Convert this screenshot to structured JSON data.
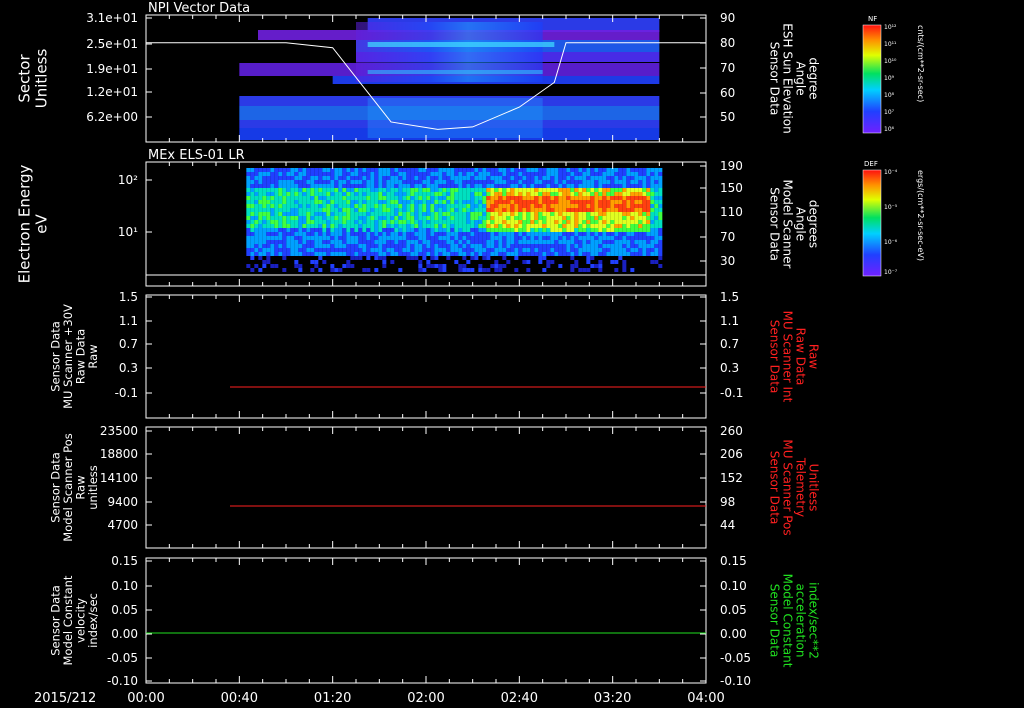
{
  "date_label": "2015/212",
  "x_ticks": [
    "00:00",
    "00:40",
    "01:20",
    "02:00",
    "02:40",
    "03:20",
    "04:00"
  ],
  "colorbars": [
    {
      "tag": "NF",
      "unit": "cnts/(cm**2-sr-sec)",
      "max_label": "10¹²",
      "min_label": "10⁶",
      "mid_labels": [
        "10¹¹",
        "10¹⁰",
        "10⁹",
        "10⁸",
        "10⁷"
      ]
    },
    {
      "tag": "DEF",
      "unit": "ergs/(cm**2-sr-sec-eV)",
      "max_label": "10⁻⁴",
      "min_label": "10⁻⁷",
      "mid_labels": [
        "10⁻⁵",
        "10⁻⁶"
      ]
    }
  ],
  "panels": [
    {
      "title": "NPI Vector Data",
      "left_label": [
        "Sector",
        "Unitless"
      ],
      "right_label": [
        "Sensor Data",
        "ESH Sun Elevation",
        "Angle",
        "degree"
      ],
      "right_label_color": "#ffffff",
      "left_ticks": [
        "3.1e+01",
        "2.5e+01",
        "1.9e+01",
        "1.2e+01",
        "6.2e+00"
      ],
      "right_ticks": [
        "90",
        "80",
        "70",
        "60",
        "50"
      ]
    },
    {
      "title": "MEx ELS-01 LR",
      "left_label": [
        "Electron Energy",
        "eV"
      ],
      "right_label": [
        "Sensor Data",
        "Model Scanner",
        "Angle",
        "degrees"
      ],
      "right_label_color": "#ffffff",
      "left_ticks": [
        "10²",
        "10¹"
      ],
      "right_ticks": [
        "190",
        "150",
        "110",
        "70",
        "30"
      ]
    },
    {
      "title": "",
      "left_label": [
        "Sensor Data",
        "MU Scanner +30V",
        "Raw Data",
        "Raw"
      ],
      "right_label": [
        "Sensor Data",
        "MU Scanner Int",
        "Raw Data",
        "Raw"
      ],
      "right_label_color": "#ff2020",
      "left_ticks": [
        "1.5",
        "1.1",
        "0.7",
        "0.3",
        "-0.1"
      ],
      "right_ticks": [
        "1.5",
        "1.1",
        "0.7",
        "0.3",
        "-0.1"
      ]
    },
    {
      "title": "",
      "left_label": [
        "Sensor Data",
        "Model Scanner Pos",
        "Raw",
        "unitless"
      ],
      "right_label": [
        "Sensor Data",
        "MU Scanner Pos",
        "Telemetry",
        "Unitless"
      ],
      "right_label_color": "#ff2020",
      "left_ticks": [
        "23500",
        "18800",
        "14100",
        "9400",
        "4700"
      ],
      "right_ticks": [
        "260",
        "206",
        "152",
        "98",
        "44"
      ]
    },
    {
      "title": "",
      "left_label": [
        "Sensor Data",
        "Model Constant",
        "velocity",
        "index/sec"
      ],
      "right_label": [
        "Sensor Data",
        "Model Constant",
        "acceleration",
        "index/sec**2"
      ],
      "right_label_color": "#20e020",
      "left_ticks": [
        "0.15",
        "0.10",
        "0.05",
        "0.00",
        "-0.05",
        "-0.10"
      ],
      "right_ticks": [
        "0.15",
        "0.10",
        "0.05",
        "0.00",
        "-0.05",
        "-0.10"
      ]
    }
  ],
  "chart_data": [
    {
      "type": "heatmap",
      "title": "NPI Vector Data",
      "ylabel": "Sector Unitless",
      "x_range": [
        "00:00",
        "04:00"
      ],
      "data_start": "00:40",
      "data_end": "03:40",
      "overlay_series": {
        "name": "Sensor Data ESH Sun Elevation Angle",
        "unit": "degree",
        "x": [
          "00:00",
          "01:00",
          "01:20",
          "01:30",
          "01:45",
          "02:05",
          "02:20",
          "02:40",
          "02:55",
          "03:00",
          "04:00"
        ],
        "y": [
          80,
          80,
          78,
          66,
          48,
          45,
          46,
          54,
          64,
          80,
          80
        ]
      }
    },
    {
      "type": "heatmap",
      "title": "MEx ELS-01 LR",
      "ylabel": "Electron Energy eV",
      "yscale": "log",
      "x_range": [
        "00:00",
        "04:00"
      ],
      "data_start": "00:43",
      "data_end": "03:40",
      "overlay_series": {
        "name": "Sensor Data Model Scanner Angle",
        "unit": "degrees",
        "x": [
          "00:00",
          "04:00"
        ],
        "y": [
          -10,
          -10
        ]
      }
    },
    {
      "type": "line",
      "ylabel": "Sensor Data MU Scanner +30V Raw Data Raw",
      "ylim": [
        -0.3,
        1.5
      ],
      "series": [
        {
          "name": "Sensor Data MU Scanner Int Raw Data Raw",
          "color": "#ff2020",
          "x": [
            "00:36",
            "04:00"
          ],
          "y": [
            0.0,
            0.0
          ]
        }
      ]
    },
    {
      "type": "line",
      "ylabel": "Sensor Data Model Scanner Pos Raw unitless",
      "ylim": [
        0,
        23500
      ],
      "series": [
        {
          "name": "Sensor Data MU Scanner Pos Telemetry Unitless",
          "color": "#ff2020",
          "x": [
            "00:36",
            "04:00"
          ],
          "y": [
            8500,
            8500
          ]
        }
      ]
    },
    {
      "type": "line",
      "ylabel": "Sensor Data Model Constant velocity index/sec",
      "ylim": [
        -0.1,
        0.15
      ],
      "series": [
        {
          "name": "Sensor Data Model Constant acceleration index/sec**2",
          "color": "#20e020",
          "x": [
            "00:00",
            "04:00"
          ],
          "y": [
            0.0,
            0.0
          ]
        }
      ]
    }
  ]
}
